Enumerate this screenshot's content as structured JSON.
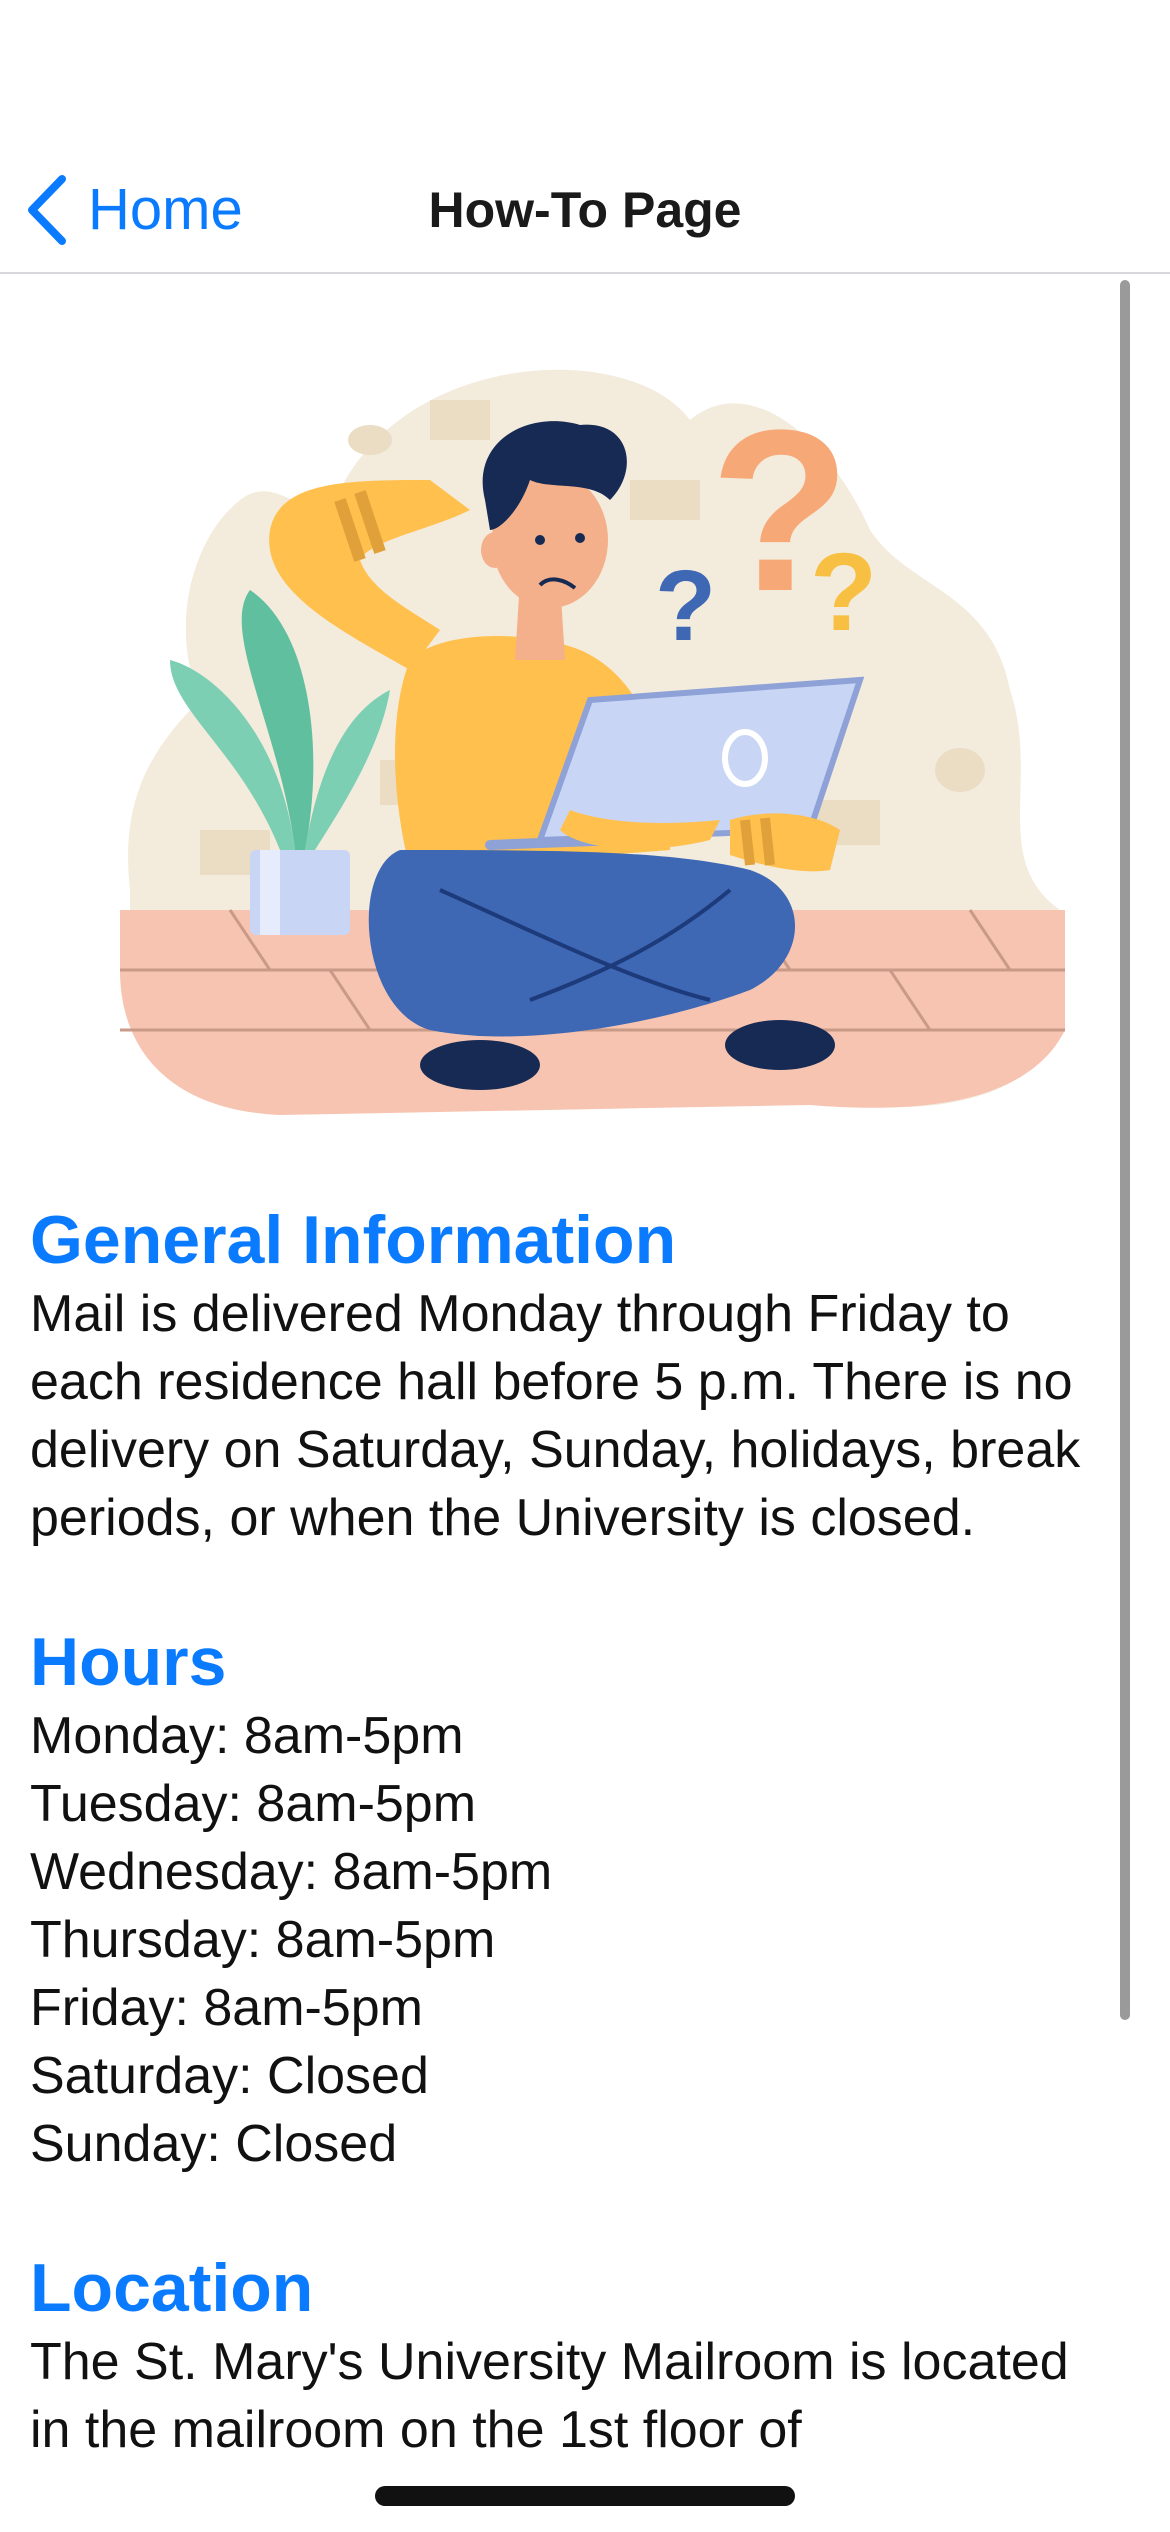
{
  "nav": {
    "back_label": "Home",
    "title": "How-To Page"
  },
  "illustration": {
    "icon": "confused-person-with-laptop-illustration",
    "colors": {
      "blob": "#f3ebdc",
      "floor": "#f6c4b0",
      "shirt": "#ffc04d",
      "pants": "#3e67b4",
      "laptop": "#c9d5f5",
      "question_orange": "#f7a877",
      "question_yellow": "#f8c042",
      "question_blue": "#3e67b4",
      "plant": "#7ccfb3"
    }
  },
  "sections": {
    "general": {
      "heading": "General Information",
      "body": "Mail is delivered Monday through Friday to each residence hall before 5 p.m. There is no delivery on Saturday, Sunday, holidays, break periods, or when the University is closed."
    },
    "hours": {
      "heading": "Hours",
      "lines": [
        "Monday: 8am-5pm",
        "Tuesday: 8am-5pm",
        "Wednesday: 8am-5pm",
        "Thursday: 8am-5pm",
        "Friday: 8am-5pm",
        "Saturday: Closed",
        "Sunday: Closed"
      ]
    },
    "location": {
      "heading": "Location",
      "body": "The St. Mary's University Mailroom is located in the mailroom on the 1st floor of"
    }
  },
  "colors": {
    "accent": "#0a7bff",
    "text": "#111111",
    "divider": "#d8d8dc"
  }
}
